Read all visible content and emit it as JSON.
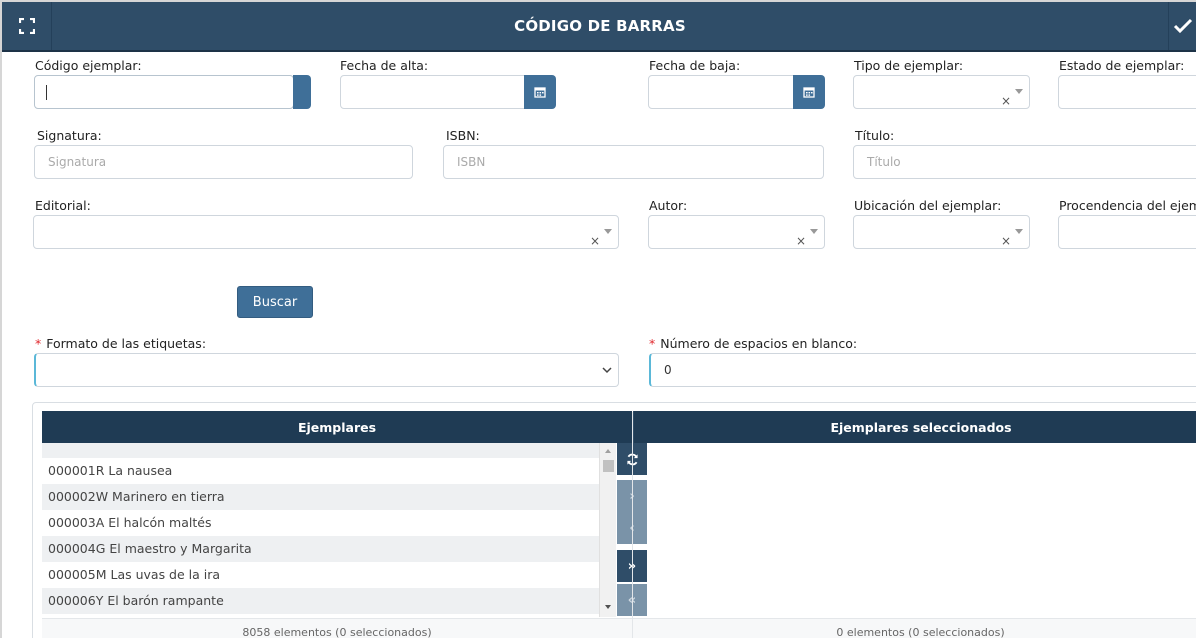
{
  "header": {
    "title": "CÓDIGO DE BARRAS",
    "expand_icon": "expand-icon",
    "confirm_icon": "check-icon"
  },
  "filters": {
    "codigo_label": "Código ejemplar:",
    "codigo_value": "",
    "fecha_alta_label": "Fecha de alta:",
    "fecha_baja_label": "Fecha de baja:",
    "tipo_label": "Tipo de ejemplar:",
    "estado_label": "Estado de ejemplar:",
    "signatura_label": "Signatura:",
    "signatura_placeholder": "Signatura",
    "isbn_label": "ISBN:",
    "isbn_placeholder": "ISBN",
    "titulo_label": "Título:",
    "titulo_placeholder": "Título",
    "editorial_label": "Editorial:",
    "autor_label": "Autor:",
    "ubicacion_label": "Ubicación del ejemplar:",
    "procedencia_label": "Procendencia del ejem",
    "clear_symbol": "×",
    "search_button": "Buscar"
  },
  "labels_config": {
    "required_mark": "*",
    "formato_label": "Formato de las etiquetas:",
    "formato_value": "",
    "espacios_label": "Número de espacios en blanco:",
    "espacios_value": "0"
  },
  "lists": {
    "available_header": "Ejemplares",
    "selected_header": "Ejemplares seleccionados",
    "available_items": [
      "000001R La nausea",
      "000002W Marinero en tierra",
      "000003A El halcón maltés",
      "000004G El maestro y Margarita",
      "000005M Las uvas de la ira",
      "000006Y El barón rampante"
    ],
    "available_count": "8058 elementos (0 seleccionados)",
    "selected_count": "0 elementos (0 seleccionados)",
    "controls": {
      "refresh": "refresh-icon",
      "move_right": "›",
      "move_left": "‹",
      "move_all_right": "»",
      "move_all_left": "«"
    }
  },
  "colors": {
    "header_bg": "#2f4d68",
    "button_bg": "#3f6f98",
    "list_header_bg": "#1f3b54",
    "required": "#e0262b",
    "focus_accent": "#5bb8d8"
  }
}
